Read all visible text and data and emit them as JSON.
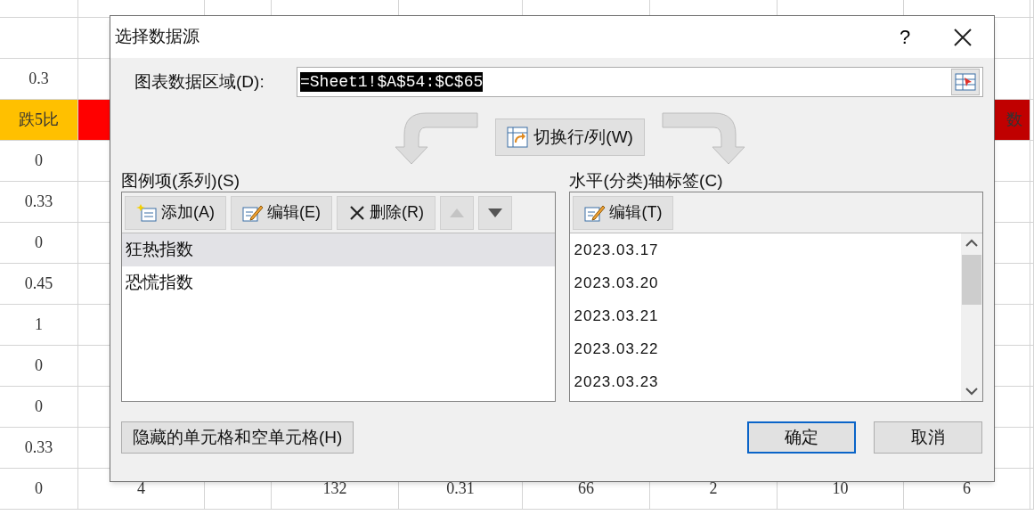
{
  "sheet": {
    "rows": [
      {},
      {},
      {
        "column_1": "0.3"
      },
      {
        "column_1": {
          "text": "跌5比",
          "color": "#ffc000"
        },
        "column_2": {
          "color": "#ff0000"
        },
        "column_9": {
          "text": "数",
          "color": "#c00000"
        }
      },
      {
        "column_1": "0"
      },
      {
        "column_1": "0.33"
      },
      {
        "column_1": "0"
      },
      {
        "column_1": "0.45"
      },
      {
        "column_1": "1"
      },
      {
        "column_1": "0"
      },
      {
        "column_1": "0"
      },
      {
        "column_1": "0.33"
      },
      {
        "column_1": "0",
        "column_2": "4",
        "column_4": "132",
        "column_5": "0.31",
        "column_6": "66",
        "column_7": "2",
        "column_8": "10",
        "column_9": "6"
      }
    ]
  },
  "dialog": {
    "title": "选择数据源",
    "help": "?",
    "data_range": {
      "label": "图表数据区域(D):",
      "value": "=Sheet1!$A$54:$C$65",
      "selected": true
    },
    "switch_button": "切换行/列(W)",
    "series": {
      "label": "图例项(系列)(S)",
      "toolbar": [
        {
          "kind": "add",
          "label": "添加(A)",
          "disabled": false
        },
        {
          "kind": "edit",
          "label": "编辑(E)",
          "disabled": false
        },
        {
          "kind": "delete",
          "label": "删除(R)",
          "disabled": false
        },
        {
          "kind": "move_up",
          "disabled": true
        },
        {
          "kind": "move_down",
          "disabled": false
        }
      ],
      "items": [
        {
          "label": "狂热指数",
          "selected": true
        },
        {
          "label": "恐慌指数",
          "selected": false
        }
      ]
    },
    "axis_labels": {
      "label": "水平(分类)轴标签(C)",
      "toolbar": [
        {
          "kind": "edit",
          "label": "编辑(T)",
          "disabled": false
        }
      ],
      "items": [
        "2023.03.17",
        "2023.03.20",
        "2023.03.21",
        "2023.03.22",
        "2023.03.23"
      ]
    },
    "hidden_cells_button": "隐藏的单元格和空单元格(H)",
    "buttons": [
      {
        "label": "确定",
        "default": true
      },
      {
        "label": "取消",
        "default": false
      }
    ]
  }
}
